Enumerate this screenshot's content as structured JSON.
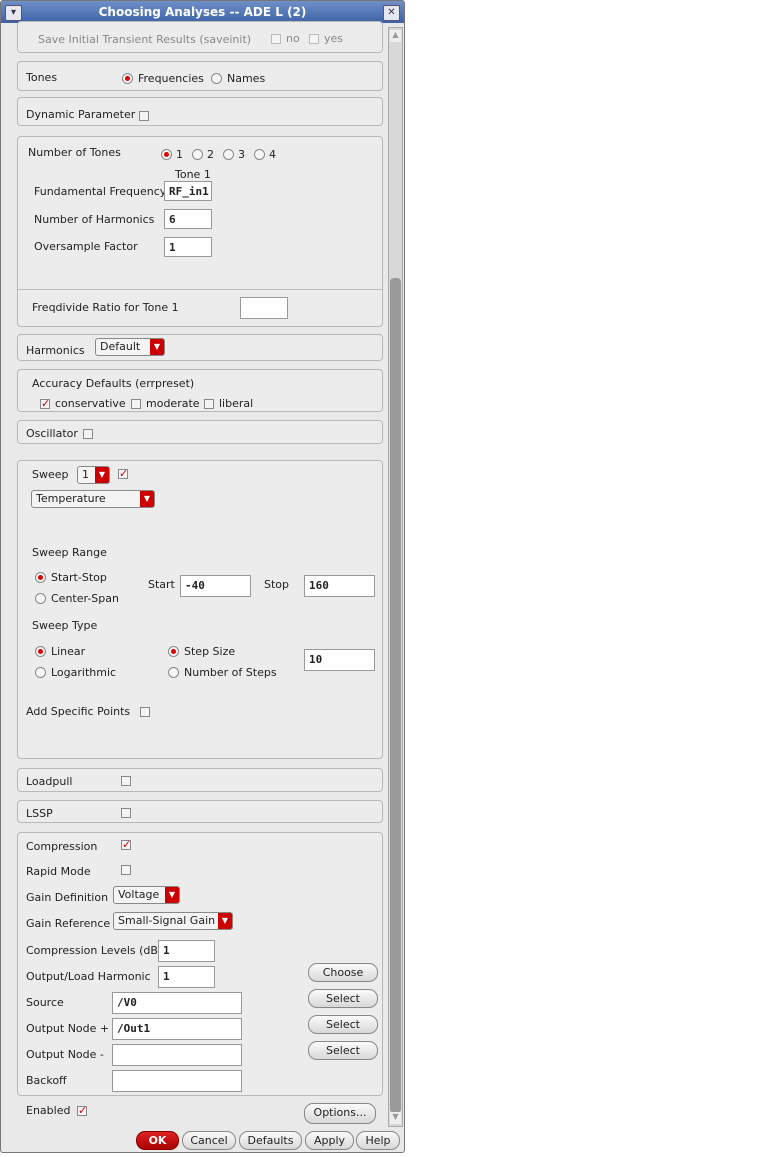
{
  "window": {
    "title": "Choosing Analyses -- ADE L (2)"
  },
  "saveinit": {
    "label": "Save Initial Transient Results (saveinit)",
    "no": "no",
    "yes": "yes"
  },
  "tones": {
    "label": "Tones",
    "frequencies": "Frequencies",
    "names": "Names",
    "selected": "Frequencies"
  },
  "dynamic": {
    "label": "Dynamic Parameter",
    "checked": false
  },
  "tonegroup": {
    "label": "Number of Tones",
    "options": [
      "1",
      "2",
      "3",
      "4"
    ],
    "selected": "1",
    "column": "Tone 1",
    "fund_label": "Fundamental Frequency",
    "fund_value": "RF_in1",
    "harm_label": "Number of Harmonics",
    "harm_value": "6",
    "over_label": "Oversample Factor",
    "over_value": "1",
    "freqdiv_label": "Freqdivide Ratio for Tone 1",
    "freqdiv_value": ""
  },
  "harmonics": {
    "label": "Harmonics",
    "value": "Default"
  },
  "accuracy": {
    "label": "Accuracy Defaults (errpreset)",
    "options": [
      "conservative",
      "moderate",
      "liberal"
    ],
    "selected": "conservative"
  },
  "oscillator": {
    "label": "Oscillator",
    "checked": false
  },
  "sweep": {
    "label": "Sweep",
    "count": "1",
    "checked": true,
    "variable": "Temperature",
    "range_label": "Sweep Range",
    "start_stop": "Start-Stop",
    "center_span": "Center-Span",
    "start_label": "Start",
    "start_value": "-40",
    "stop_label": "Stop",
    "stop_value": "160",
    "type_label": "Sweep Type",
    "linear": "Linear",
    "log": "Logarithmic",
    "step_size": "Step Size",
    "num_steps": "Number of Steps",
    "step_value": "10",
    "specific_label": "Add Specific Points"
  },
  "loadpull": {
    "label": "Loadpull",
    "checked": false
  },
  "lssp": {
    "label": "LSSP",
    "checked": false
  },
  "compression": {
    "label": "Compression",
    "checked": true,
    "rapid_label": "Rapid Mode",
    "gain_def_label": "Gain Definition",
    "gain_def": "Voltage",
    "gain_ref_label": "Gain Reference",
    "gain_ref": "Small-Signal Gain",
    "levels_label": "Compression Levels (dB)",
    "levels_value": "1",
    "harm_label": "Output/Load Harmonic",
    "harm_value": "1",
    "source_label": "Source",
    "source_value": "/V0",
    "outp_label": "Output Node +",
    "outp_value": "/Out1",
    "outn_label": "Output Node -",
    "outn_value": "",
    "backoff_label": "Backoff",
    "backoff_value": "",
    "choose": "Choose",
    "select": "Select"
  },
  "enabled": {
    "label": "Enabled",
    "checked": true
  },
  "buttons": {
    "options": "Options...",
    "ok": "OK",
    "cancel": "Cancel",
    "defaults": "Defaults",
    "apply": "Apply",
    "help": "Help"
  }
}
